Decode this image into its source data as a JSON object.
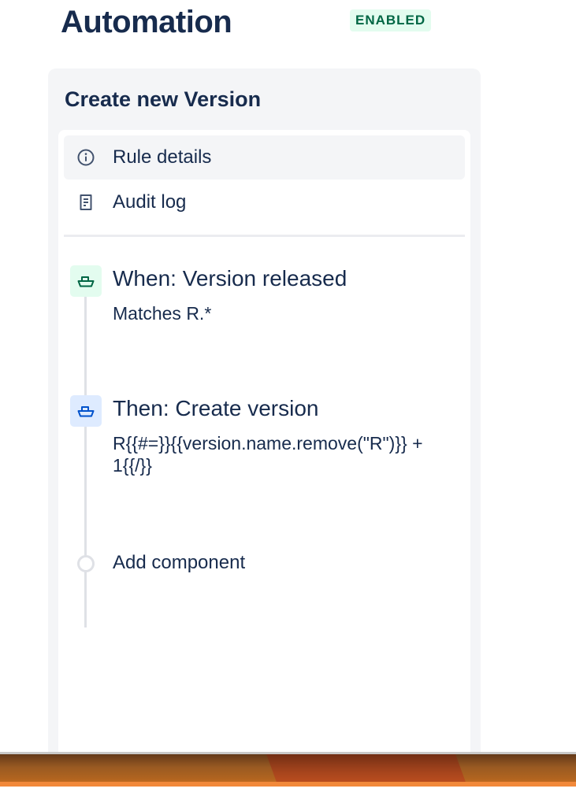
{
  "header": {
    "title": "Automation",
    "status": "ENABLED"
  },
  "rule": {
    "name": "Create new Version",
    "nav": [
      {
        "label": "Rule details",
        "icon": "info-icon",
        "active": true
      },
      {
        "label": "Audit log",
        "icon": "document-icon",
        "active": false
      }
    ],
    "trigger": {
      "title": "When: Version released",
      "description": "Matches R.*",
      "icon": "ship-icon"
    },
    "action": {
      "title": "Then: Create version",
      "description": "R{{#=}}{{version.name.remove(\"R\")}} + 1{{/}}",
      "icon": "ship-icon"
    },
    "add_component_label": "Add component"
  },
  "colors": {
    "text": "#172b4d",
    "enabled_bg": "#e3fcef",
    "enabled_text": "#006644",
    "trigger_icon": "#006644",
    "action_icon": "#0052cc"
  }
}
